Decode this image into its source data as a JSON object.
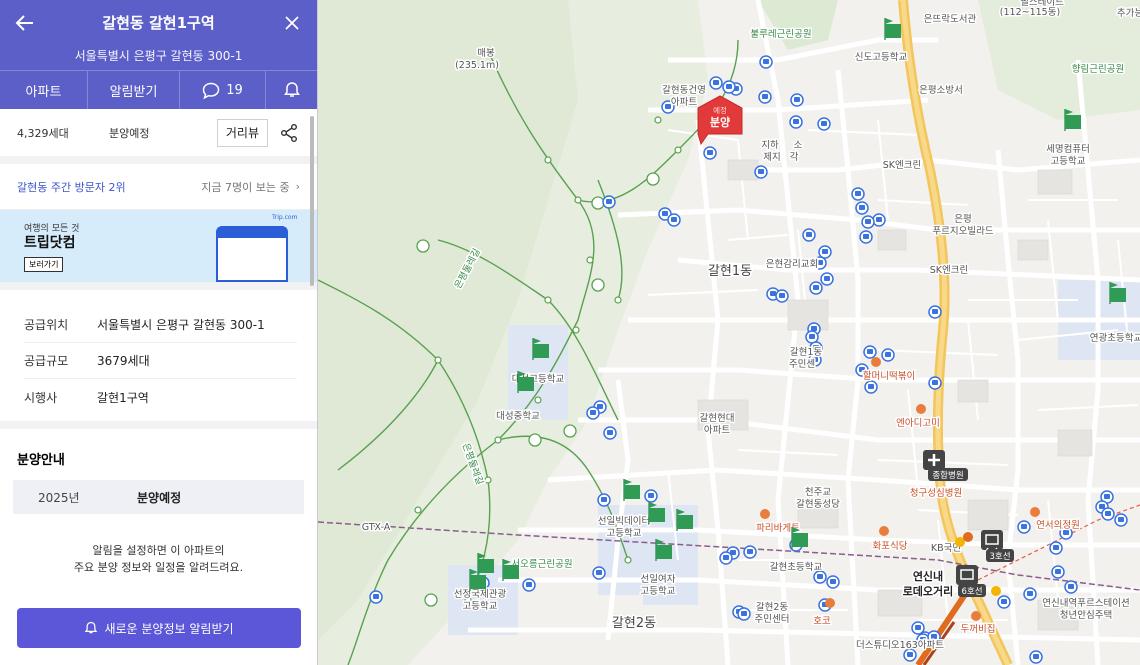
{
  "header": {
    "title": "갈현동 갈현1구역",
    "address": "서울특별시 은평구 갈현동 300-1",
    "tabs": {
      "apartment": "아파트",
      "alert": "알림받기",
      "comments_count": "19"
    }
  },
  "summary": {
    "units": "4,329세대",
    "status": "분양예정",
    "street_view": "거리뷰"
  },
  "rank": {
    "text": "갈현동 주간 방문자 2위",
    "viewers": "지금 7명이 보는 중"
  },
  "ad": {
    "tagline": "여행의 모든 것",
    "brand": "트립닷컴",
    "button": "보러가기",
    "logo": "Trip.com"
  },
  "info": {
    "rows": [
      {
        "key": "공급위치",
        "value": "서울특별시 은평구 갈현동 300-1"
      },
      {
        "key": "공급규모",
        "value": "3679세대"
      },
      {
        "key": "시행사",
        "value": "갈현1구역"
      }
    ]
  },
  "sale": {
    "heading": "분양안내",
    "year": "2025년",
    "state": "분양예정",
    "message_line1": "알림을 설정하면 이 아파트의",
    "message_line2": "주요 분양 정보와 일정을 알려드려요.",
    "cta": "새로운 분양정보 알림받기"
  },
  "map": {
    "marker": {
      "small": "예정",
      "big": "분양"
    },
    "labels": {
      "mountain": "매봉",
      "mountain_h": "(235.1m)",
      "apt1": "갈현동건영",
      "apt1b": "아파트",
      "park1": "불루레근린공원",
      "school1": "신도고등학교",
      "lib": "은뜨락도서관",
      "fire": "은평소방서",
      "park2": "향림근린공원",
      "school2a": "세명컴퓨터",
      "school2b": "고등학교",
      "sk1": "SK엔크린",
      "sk2": "SK엔크린",
      "station1a": "지하",
      "station1b": "소",
      "station1c": "제지",
      "station1d": "각",
      "villa": "은평",
      "villa2": "푸르지오빌라드",
      "church": "은현감리교회",
      "dong1": "갈현1동",
      "school3": "연광초등학교",
      "center1a": "갈현1동",
      "center1b": "주민센",
      "halmeoni": "할머니떡볶이",
      "school4a": "대성고등학교",
      "school4b": "대성중학교",
      "apt2a": "갈현현대",
      "apt2b": "아파트",
      "yeonda": "엔아디고미",
      "hosp": "종합병원",
      "hosp2": "청구성심병원",
      "church2a": "천주교",
      "church2b": "갈현동성당",
      "school5a": "선일빅데이터",
      "school5b": "고등학교",
      "paris": "파리바게트",
      "school6a": "선일여자",
      "school6b": "고등학교",
      "school7": "갈현초등학교",
      "hwa": "화포식당",
      "kb": "KB국민",
      "yeonsin1": "연신내",
      "yeonsin2": "로데오거리",
      "yeonsim": "연서의정원",
      "park3": "서오릉근린공원",
      "school8a": "선정국제관광",
      "school8b": "고등학교",
      "dong2": "갈현2동",
      "center2a": "갈현2동",
      "center2b": "주민센터",
      "hoko": "호코",
      "ds": "더스튜디오163아파트",
      "tw": "두꺼비집",
      "youth1": "연신내역푸르스테이션",
      "youth2": "청년안심주택",
      "gtx": "GTX-A",
      "line3": "3호선",
      "line6": "6호선",
      "topright1": "필스테이트",
      "topright2": "(112~115동)",
      "topright3": "추가능",
      "trail": "은평둘레길",
      "station": "역"
    }
  },
  "colors": {
    "brand": "#5b5fc7",
    "cta": "#5b57d8",
    "marker": "#e23a3a",
    "bus": "#3a72e0",
    "trail": "#59a14f",
    "road": "#f3c55a"
  }
}
